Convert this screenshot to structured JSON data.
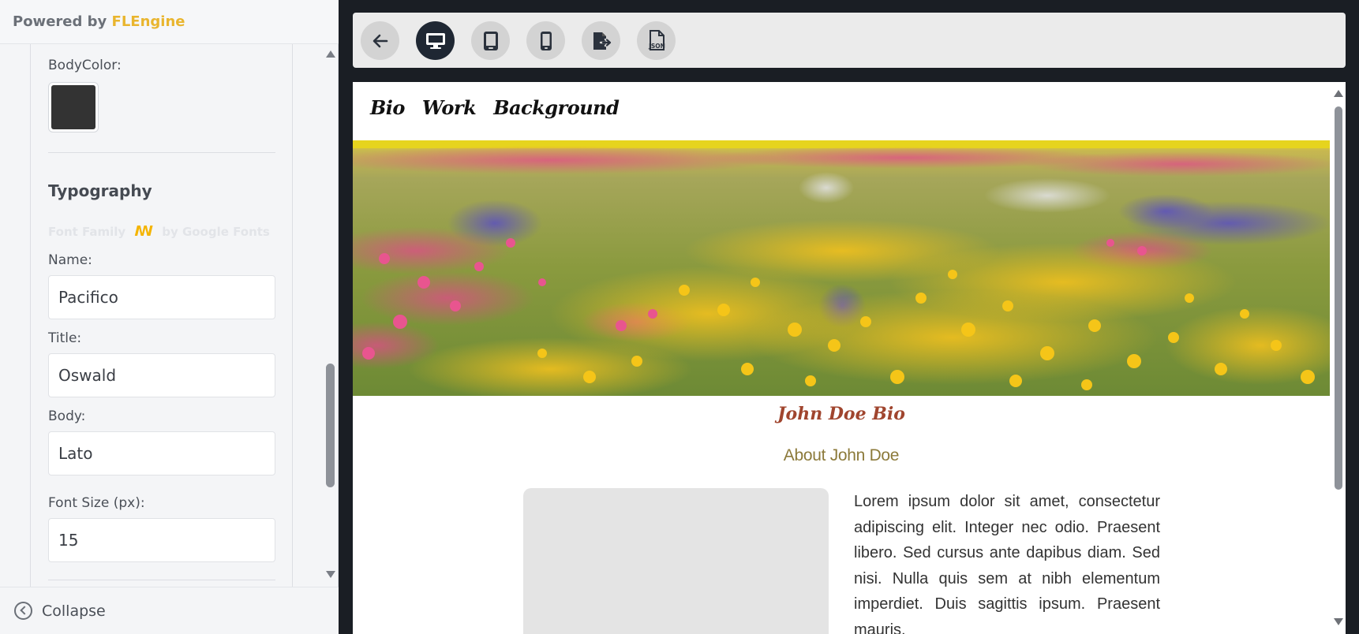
{
  "brand": {
    "prefix": "Powered by",
    "name": "FLEngine",
    "accent_color": "#e9b52e"
  },
  "panel": {
    "body_color_label": "BodyColor:",
    "body_color_value": "#333333",
    "typography_title": "Typography",
    "font_family_label": "Font Family",
    "google_fonts_label": "by Google Fonts",
    "name_label": "Name:",
    "name_value": "Pacifico",
    "title_label": "Title:",
    "title_value": "Oswald",
    "body_label": "Body:",
    "body_value": "Lato",
    "font_size_label": "Font Size (px):",
    "font_size_value": "15",
    "collapse_label": "Collapse"
  },
  "toolbar": {
    "buttons": [
      {
        "icon": "back-arrow-icon",
        "active": false
      },
      {
        "icon": "desktop-icon",
        "active": true
      },
      {
        "icon": "tablet-icon",
        "active": false
      },
      {
        "icon": "mobile-icon",
        "active": false
      },
      {
        "icon": "export-icon",
        "active": false
      },
      {
        "icon": "json-file-icon",
        "active": false,
        "label": "JSON"
      }
    ]
  },
  "preview": {
    "nav": [
      "Bio",
      "Work",
      "Background"
    ],
    "bio_title": "John Doe Bio",
    "about_title": "About John Doe",
    "bio_text": "Lorem ipsum dolor sit amet, consectetur adipiscing elit. Integer nec odio. Praesent libero. Sed cursus ante dapibus diam. Sed nisi. Nulla quis sem at nibh elementum imperdiet. Duis sagittis ipsum. Praesent mauris.",
    "title_color": "#a0452e",
    "about_color": "#8c7a3a"
  }
}
